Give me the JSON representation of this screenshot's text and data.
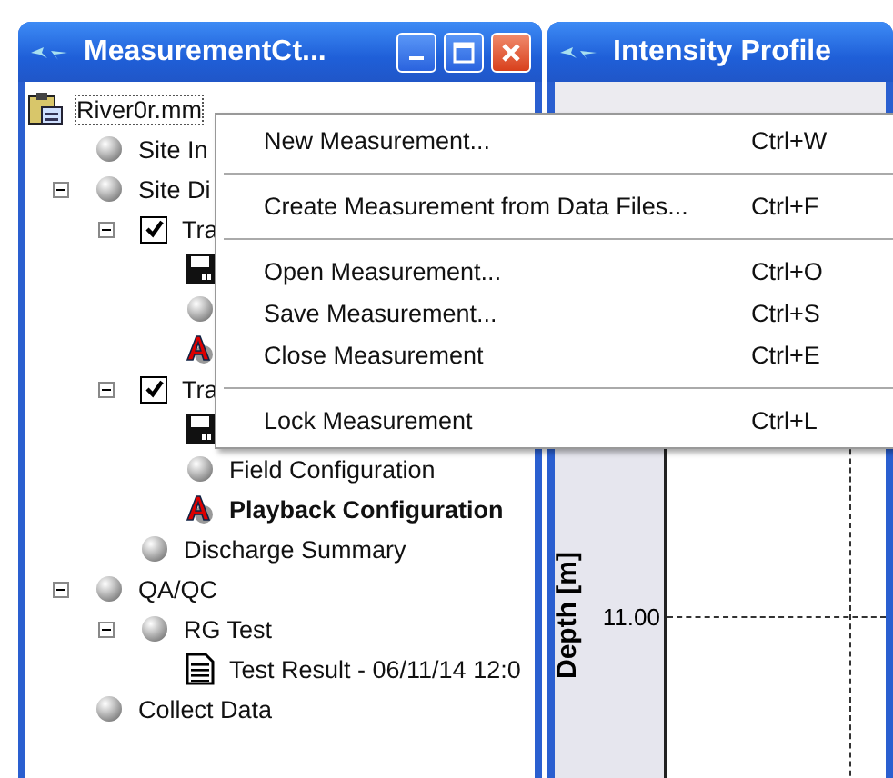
{
  "tree_window": {
    "title": "MeasurementCt...",
    "tree": [
      {
        "kind": "project",
        "label": "River0r.mm",
        "active": false,
        "children": [
          {
            "kind": "sphere",
            "label": "Site In",
            "active": false
          },
          {
            "kind": "sphere",
            "label": "Site Di",
            "active": false,
            "expanded": true,
            "children": [
              {
                "kind": "checkbox",
                "label": "Tra",
                "checked": true,
                "active": false,
                "expanded": true,
                "children": [
                  {
                    "kind": "disk"
                  },
                  {
                    "kind": "sphere"
                  },
                  {
                    "kind": "font"
                  }
                ]
              },
              {
                "kind": "checkbox",
                "label": "Tra",
                "checked": true,
                "active": false,
                "expanded": true,
                "children": [
                  {
                    "kind": "disk"
                  },
                  {
                    "kind": "sphere",
                    "label": "Field Configuration",
                    "active": false
                  },
                  {
                    "kind": "font",
                    "label": "Playback Configuration",
                    "active": true
                  }
                ]
              },
              {
                "kind": "sphere",
                "label": "Discharge Summary",
                "active": false
              }
            ]
          },
          {
            "kind": "sphere",
            "label": "QA/QC",
            "active": false,
            "expanded": true,
            "children": [
              {
                "kind": "sphere",
                "label": "RG Test",
                "active": false,
                "expanded": true,
                "children": [
                  {
                    "kind": "document",
                    "label": "Test Result - 06/11/14 12:0",
                    "active": false
                  }
                ]
              }
            ]
          },
          {
            "kind": "sphere",
            "label": "Collect Data",
            "active": false
          }
        ]
      }
    ]
  },
  "context_menu": {
    "items": [
      {
        "kind": "item",
        "label": "New Measurement...",
        "shortcut": "Ctrl+W"
      },
      {
        "kind": "separator"
      },
      {
        "kind": "item",
        "label": "Create Measurement from Data Files...",
        "shortcut": "Ctrl+F"
      },
      {
        "kind": "separator"
      },
      {
        "kind": "item",
        "label": "Open Measurement...",
        "shortcut": "Ctrl+O"
      },
      {
        "kind": "item",
        "label": "Save Measurement...",
        "shortcut": "Ctrl+S"
      },
      {
        "kind": "item",
        "label": "Close Measurement",
        "shortcut": "Ctrl+E"
      },
      {
        "kind": "separator"
      },
      {
        "kind": "item",
        "label": "Lock Measurement",
        "shortcut": "Ctrl+L"
      }
    ]
  },
  "profile_window": {
    "title": "Intensity Profile",
    "y_axis_label": "Depth [m]",
    "y_tick": "11.00"
  }
}
